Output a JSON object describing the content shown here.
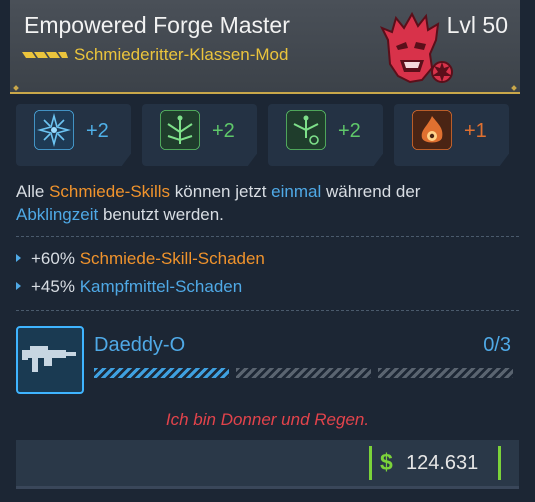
{
  "item": {
    "name": "Empowered Forge Master",
    "level": "Lvl 50",
    "type": "Schmiederitter-Klassen-Mod"
  },
  "skills": [
    {
      "bonus": "+2",
      "color": "#4fb0e8",
      "icon": "ice-tree-icon"
    },
    {
      "bonus": "+2",
      "color": "#5fc86a",
      "icon": "nature-tree-icon"
    },
    {
      "bonus": "+2",
      "color": "#5fc86a",
      "icon": "nature-tree-icon"
    },
    {
      "bonus": "+1",
      "color": "#e07030",
      "icon": "fire-icon"
    }
  ],
  "description": {
    "p1": "Alle ",
    "p2": "Schmiede-Skills",
    "p3": " können jetzt ",
    "p4": "einmal",
    "p5": " während der",
    "p6": "Abklingzeit",
    "p7": " benutzt werden."
  },
  "stats": [
    {
      "value": "+60% ",
      "label": "Schmiede-Skill-Schaden",
      "color": "orange"
    },
    {
      "value": "+45% ",
      "label": "Kampfmittel-Schaden",
      "color": "blue"
    }
  ],
  "manufacturer": {
    "name": "Daeddy-O",
    "count": "0/3",
    "progress_filled": 1,
    "progress_total": 3
  },
  "flavor_text": "Ich bin Donner und Regen.",
  "price": {
    "currency_symbol": "$",
    "amount": "124.631"
  },
  "colors": {
    "gold": "#ebc43c",
    "orange": "#f0932c",
    "blue": "#4fa9e6",
    "red": "#e2434b",
    "green": "#7bd23a"
  }
}
